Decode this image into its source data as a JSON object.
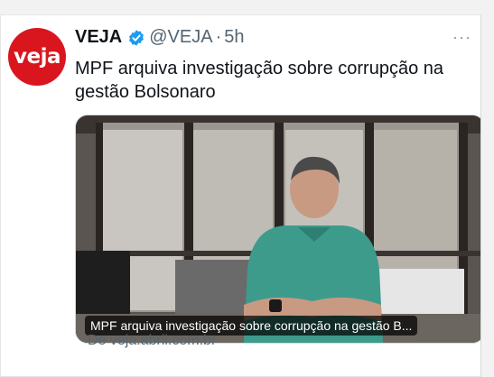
{
  "tweet": {
    "author_name": "VEJA",
    "avatar_text": "veja",
    "handle": "@VEJA",
    "separator": "·",
    "time": "5h",
    "more_glyph": "···",
    "text": "MPF arquiva investigação sobre corrupção na gestão Bolsonaro",
    "verified_color": "#1d9bf0",
    "brand_color": "#d9161e"
  },
  "card": {
    "caption": "MPF arquiva investigação sobre corrupção na gestão B...",
    "source": "De veja.abril.com.br"
  }
}
